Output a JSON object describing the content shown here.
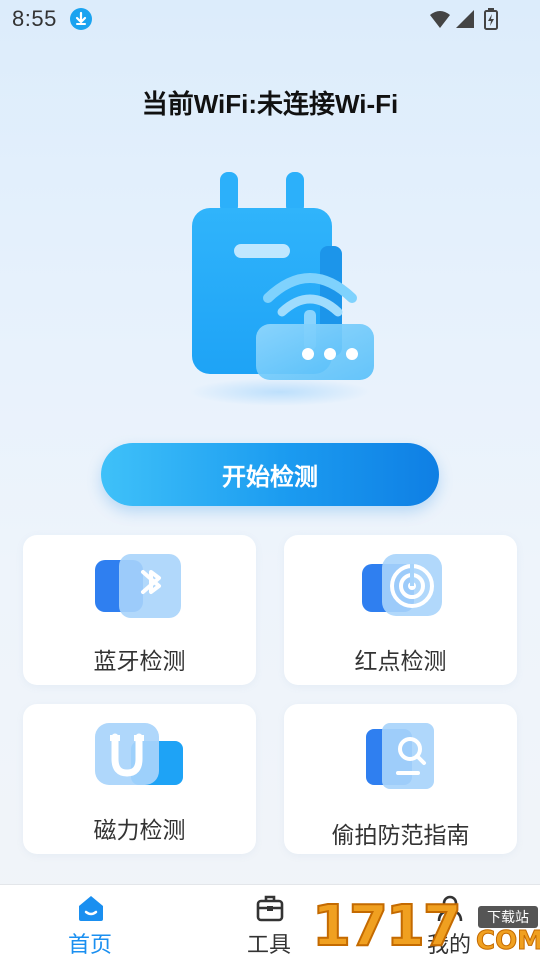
{
  "status_bar": {
    "time": "8:55",
    "download_icon": "download-arrow-icon",
    "icons": [
      "wifi-icon",
      "cell-signal-icon",
      "battery-charging-icon"
    ]
  },
  "header": {
    "wifi_status": "当前WiFi:未连接Wi-Fi"
  },
  "hero": {
    "icon": "router-wifi-illustration"
  },
  "actions": {
    "start_label": "开始检测"
  },
  "tools": [
    {
      "label": "蓝牙检测",
      "icon": "bluetooth-icon"
    },
    {
      "label": "红点检测",
      "icon": "radar-icon"
    },
    {
      "label": "磁力检测",
      "icon": "magnet-icon"
    },
    {
      "label": "偷拍防范指南",
      "icon": "guide-book-search-icon"
    }
  ],
  "bottom_nav": {
    "items": [
      {
        "label": "首页",
        "icon": "home-icon",
        "active": true
      },
      {
        "label": "工具",
        "icon": "toolbox-icon",
        "active": false
      },
      {
        "label": "我的",
        "icon": "profile-icon",
        "active": false
      }
    ]
  },
  "watermark": {
    "number": "1717",
    "tag": "下载站",
    "suffix": "COM"
  },
  "colors": {
    "accent": "#1a8ff0",
    "button_start": "#3fc1f9",
    "button_end": "#0f7fe4",
    "icon_blue": "#2f7ff0",
    "icon_light": "#a8d4fb"
  }
}
